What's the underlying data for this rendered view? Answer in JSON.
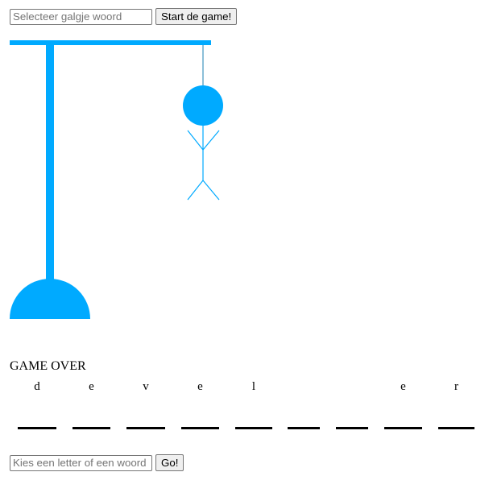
{
  "word_select": {
    "placeholder": "Selecteer galgje woord",
    "start_label": "Start de game!"
  },
  "gallows": {
    "color": "#00aaff",
    "wrong_guesses": 6
  },
  "status_text": "GAME OVER",
  "word_slots": [
    "d",
    "e",
    "v",
    "e",
    "l",
    "",
    "",
    "e",
    "r"
  ],
  "guess": {
    "placeholder": "Kies een letter of een woord",
    "go_label": "Go!"
  }
}
